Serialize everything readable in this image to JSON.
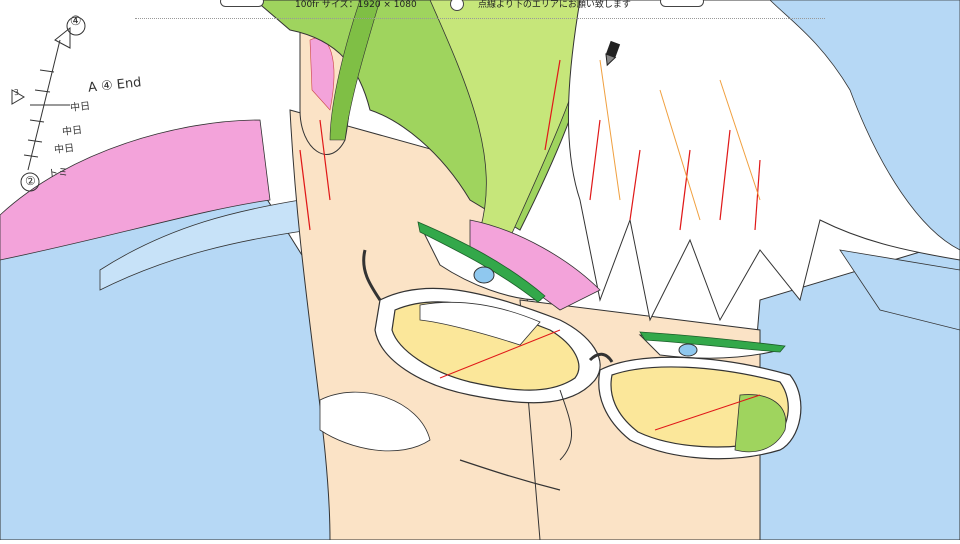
{
  "header": {
    "left_text": "100fr サイズ：1920 × 1080",
    "right_text": "点線より下のエリアにお願い致します"
  },
  "notes": {
    "circle_top": "④",
    "circle_bottom": "②",
    "left_triangle_label": "3",
    "end_label": "A ④ End",
    "tick_1": "中日",
    "tick_2": "中日",
    "tick_3": "中日",
    "tick_4": "トミ"
  },
  "colors": {
    "background": "#ffffff",
    "jacket_blue": "#b6d8f5",
    "skin_peach": "#fbe3c6",
    "hair_green": "#9fd45e",
    "hair_light_green": "#c6e67a",
    "shadow_pink": "#f3a3da",
    "hair_white": "#ffffff",
    "lens_yellow": "#fbe79a",
    "eye_green": "#33a84a",
    "red_line": "#e01818"
  }
}
